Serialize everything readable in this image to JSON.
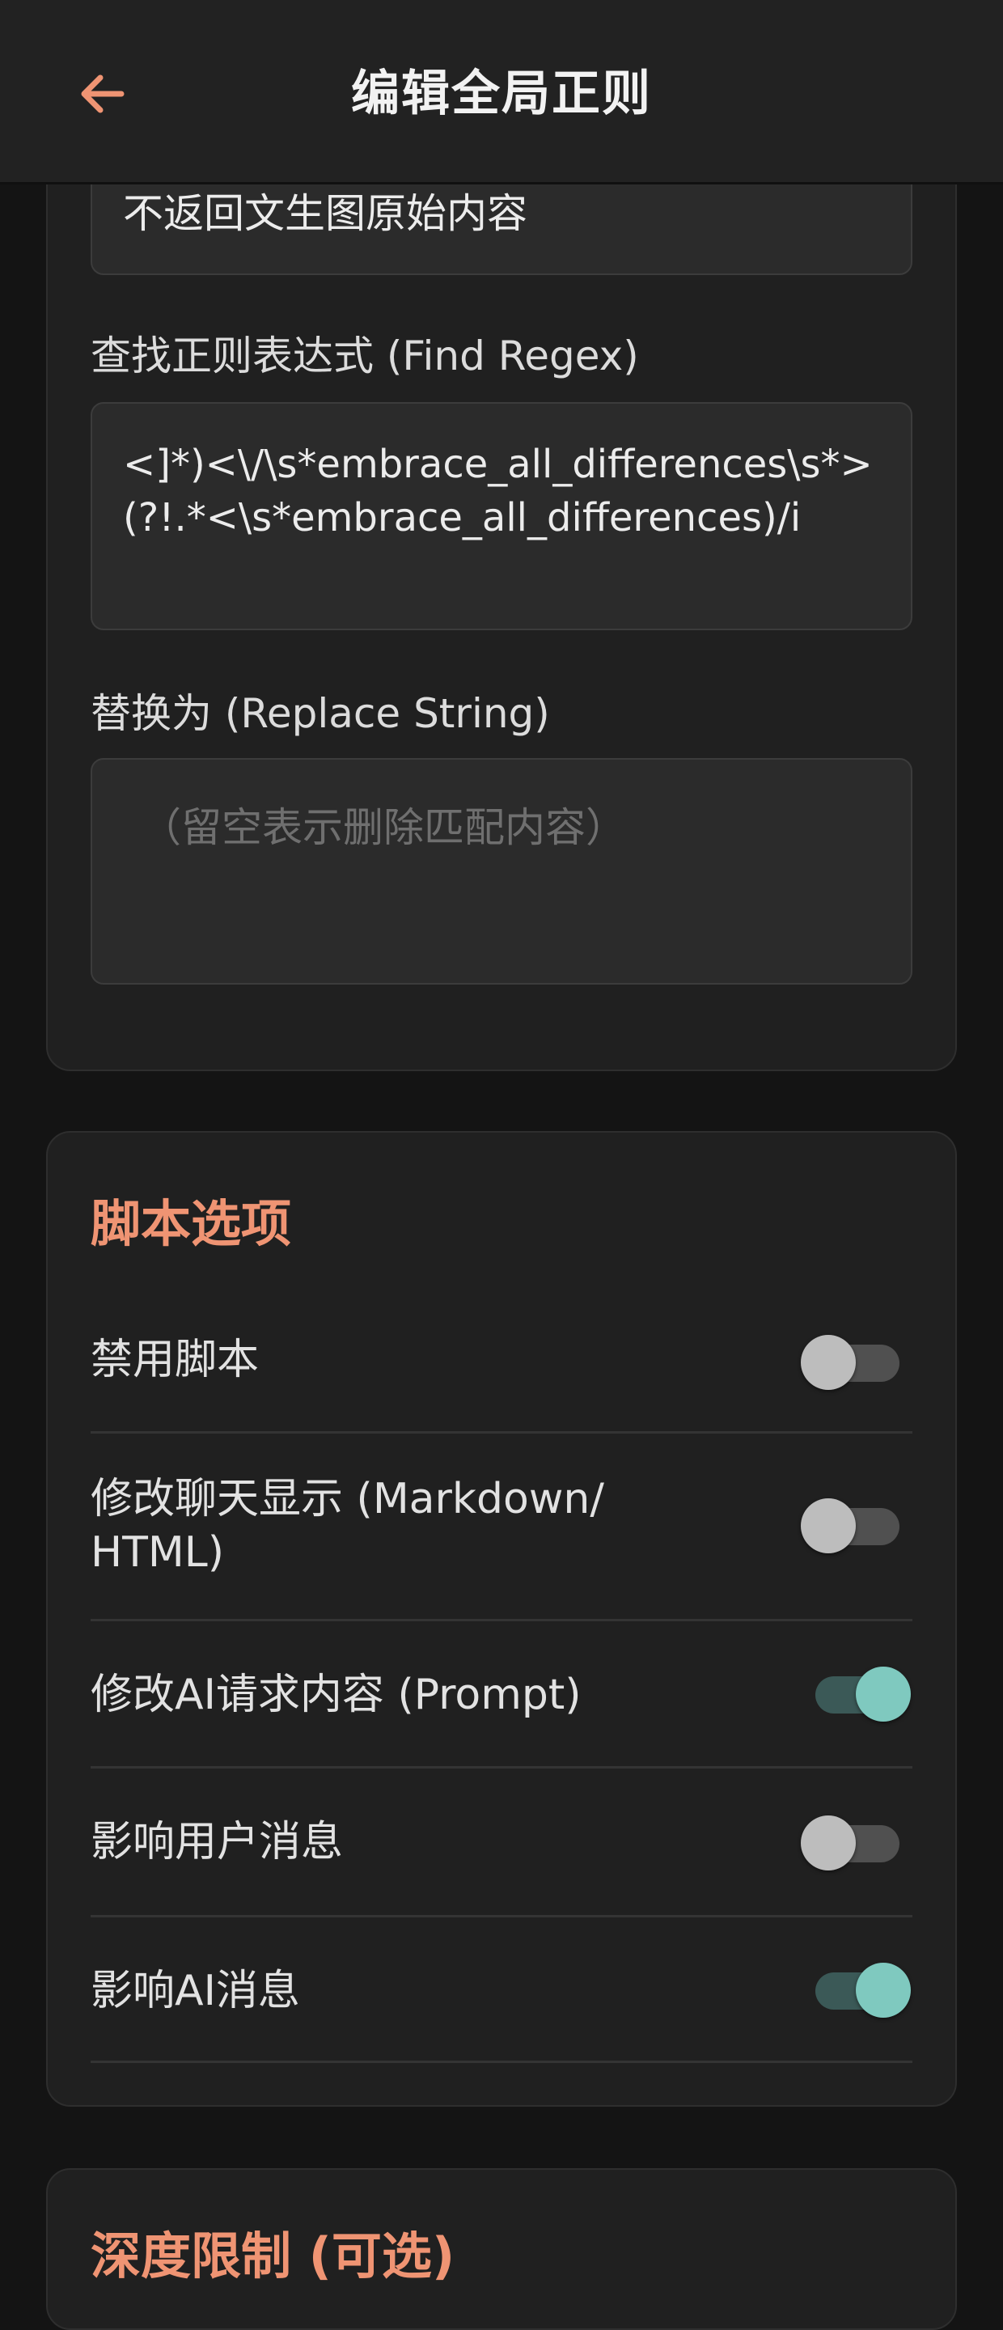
{
  "header": {
    "title": "编辑全局正则",
    "back_icon": "arrow-left-icon",
    "accent_color": "#EF9473"
  },
  "form": {
    "script_name_value": "不返回文生图原始内容",
    "find_regex": {
      "label": "查找正则表达式 (Find Regex)",
      "value": "<]*)<\\/\\s*embrace_all_differences\\s*>(?!.*<\\s*embrace_all_differences)/i"
    },
    "replace_string": {
      "label": "替换为 (Replace String)",
      "placeholder": "（留空表示删除匹配内容）",
      "value": ""
    }
  },
  "script_options": {
    "title": "脚本选项",
    "items": [
      {
        "label": "禁用脚本",
        "enabled": false
      },
      {
        "label": "修改聊天显示 (Markdown/ HTML)",
        "enabled": false
      },
      {
        "label": "修改AI请求内容 (Prompt)",
        "enabled": true
      },
      {
        "label": "影响用户消息",
        "enabled": false
      },
      {
        "label": "影响AI消息",
        "enabled": true
      }
    ],
    "toggle_on_color": "#7FC9BF",
    "toggle_off_color": "#BDBDBD"
  },
  "depth_limit": {
    "title": "深度限制 (可选)"
  }
}
